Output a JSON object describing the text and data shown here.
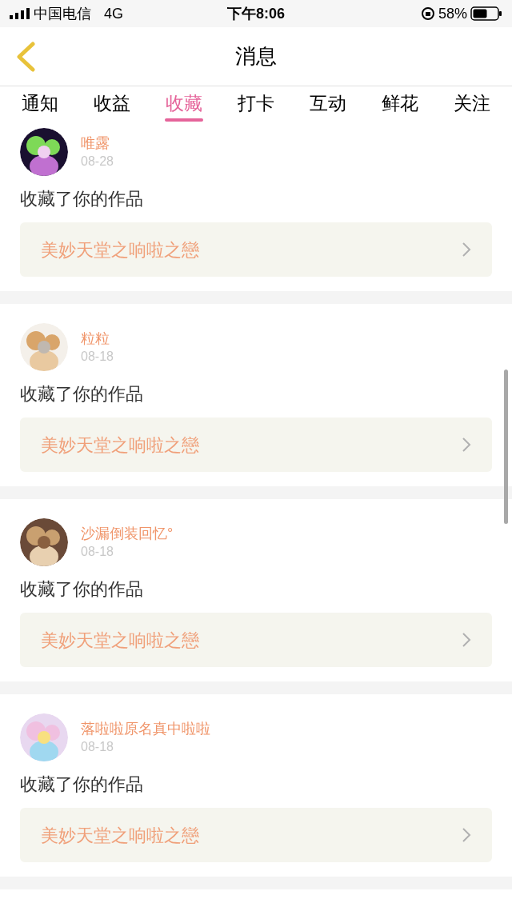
{
  "status_bar": {
    "carrier": "中国电信",
    "network": "4G",
    "time": "下午8:06",
    "battery": "58%"
  },
  "header": {
    "title": "消息"
  },
  "tabs": [
    {
      "label": "通知",
      "selected": false
    },
    {
      "label": "收益",
      "selected": false
    },
    {
      "label": "收藏",
      "selected": true
    },
    {
      "label": "打卡",
      "selected": false
    },
    {
      "label": "互动",
      "selected": false
    },
    {
      "label": "鲜花",
      "selected": false
    },
    {
      "label": "关注",
      "selected": false
    }
  ],
  "messages": [
    {
      "name": "唯露",
      "date": "08-28",
      "text": "收藏了你的作品",
      "work": "美妙天堂之响啦之戀"
    },
    {
      "name": "粒粒",
      "date": "08-18",
      "text": "收藏了你的作品",
      "work": "美妙天堂之响啦之戀"
    },
    {
      "name": "沙漏倒装回忆°",
      "date": "08-18",
      "text": "收藏了你的作品",
      "work": "美妙天堂之响啦之戀"
    },
    {
      "name": "落啦啦原名真中啦啦",
      "date": "08-18",
      "text": "收藏了你的作品",
      "work": "美妙天堂之响啦之戀"
    }
  ]
}
